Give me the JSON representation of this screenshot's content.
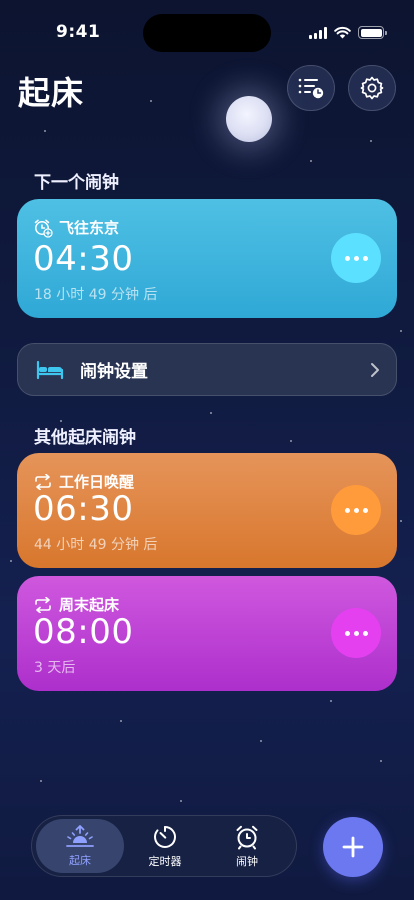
{
  "status_bar": {
    "time": "9:41"
  },
  "header": {
    "title": "起床",
    "list_button_icon": "list-clock-icon",
    "settings_button_icon": "gear-icon"
  },
  "next_section": {
    "label": "下一个闹钟",
    "alarm": {
      "icon": "alarm-clock-add-icon",
      "label": "飞往东京",
      "time": "04:30",
      "subtitle": "18 小时 49 分钟 后",
      "color": "#3cb3dd",
      "more_icon": "more-dots-icon"
    }
  },
  "settings_row": {
    "icon": "bed-icon",
    "label": "闹钟设置",
    "chevron_icon": "chevron-right-icon"
  },
  "other_section": {
    "label": "其他起床闹钟",
    "alarms": [
      {
        "icon": "repeat-icon",
        "label": "工作日唤醒",
        "time": "06:30",
        "subtitle": "44 小时 49 分钟 后",
        "color": "#de8442"
      },
      {
        "icon": "repeat-icon",
        "label": "周末起床",
        "time": "08:00",
        "subtitle": "3 天后",
        "color": "#be40d6"
      }
    ]
  },
  "tab_bar": {
    "tabs": [
      {
        "label": "起床",
        "icon": "sunrise-icon",
        "active": true
      },
      {
        "label": "定时器",
        "icon": "timer-icon",
        "active": false
      },
      {
        "label": "闹钟",
        "icon": "alarm-clock-icon",
        "active": false
      }
    ],
    "add_button_icon": "plus-icon",
    "accent_color": "#6b78f0"
  }
}
